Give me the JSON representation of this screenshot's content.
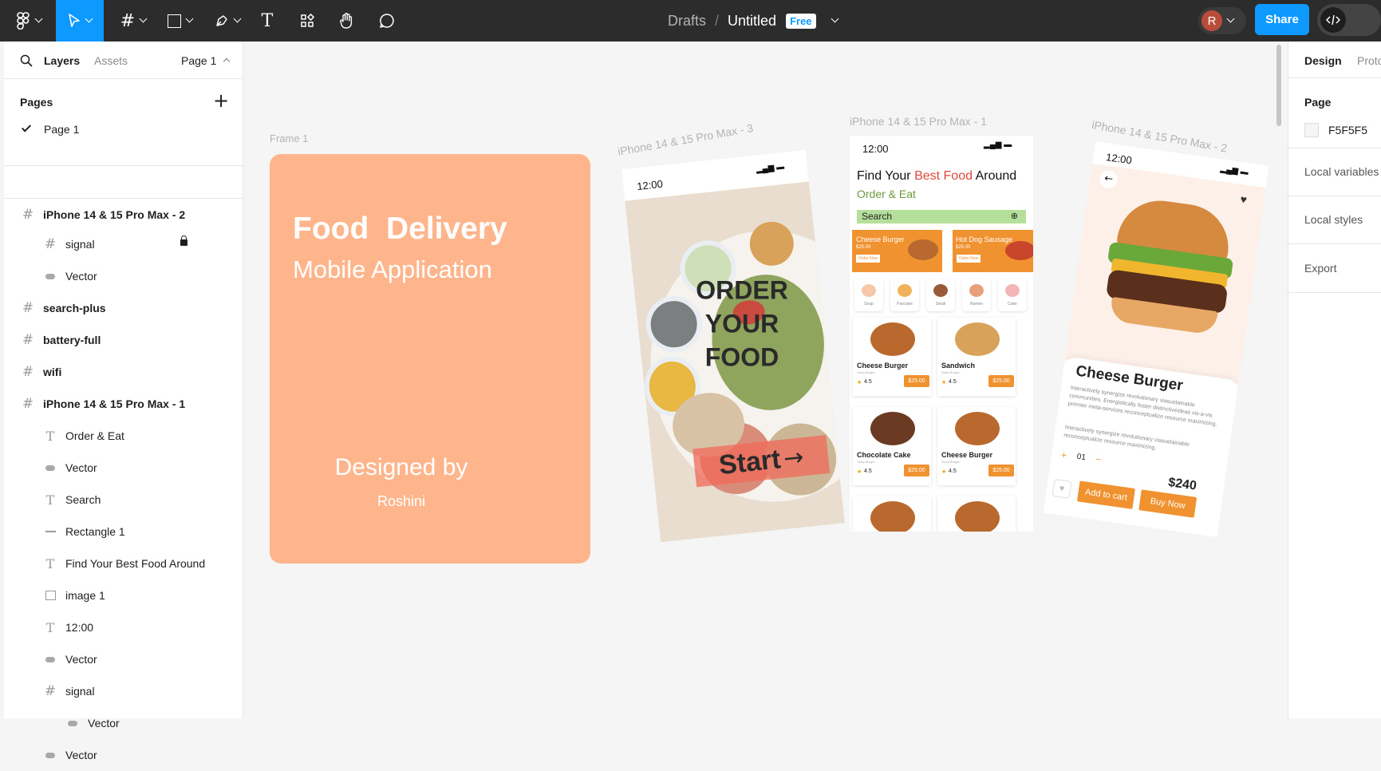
{
  "topbar": {
    "breadcrumb_drafts": "Drafts",
    "breadcrumb_sep": "/",
    "file_name": "Untitled",
    "plan_badge": "Free",
    "avatar_initial": "R",
    "share_label": "Share",
    "tools": [
      "main-menu-icon",
      "move-tool-icon",
      "frame-tool-icon",
      "shape-tool-icon",
      "pen-tool-icon",
      "text-tool-icon",
      "resources-icon",
      "hand-tool-icon",
      "comment-tool-icon"
    ]
  },
  "leftpanel": {
    "tab_layers": "Layers",
    "tab_assets": "Assets",
    "page_selector": "Page 1",
    "pages_heading": "Pages",
    "pages": [
      "Page 1"
    ],
    "layers": [
      {
        "label": "iPhone 14 & 15 Pro Max - 2",
        "icon": "frame-icon",
        "level": 0
      },
      {
        "label": "signal",
        "icon": "frame-icon",
        "level": 1,
        "locked": true
      },
      {
        "label": "Vector",
        "icon": "vector-icon",
        "level": 1
      },
      {
        "label": "search-plus",
        "icon": "frame-icon",
        "level": 0
      },
      {
        "label": "battery-full",
        "icon": "frame-icon",
        "level": 0
      },
      {
        "label": "wifi",
        "icon": "frame-icon",
        "level": 0
      },
      {
        "label": "iPhone 14 & 15 Pro Max - 1",
        "icon": "frame-icon",
        "level": 0
      },
      {
        "label": "Order & Eat",
        "icon": "text-icon",
        "level": 1
      },
      {
        "label": "Vector",
        "icon": "vector-icon",
        "level": 1
      },
      {
        "label": "Search",
        "icon": "text-icon",
        "level": 1
      },
      {
        "label": "Rectangle 1",
        "icon": "line-icon",
        "level": 1
      },
      {
        "label": "Find Your Best Food Around",
        "icon": "text-icon",
        "level": 1
      },
      {
        "label": "image 1",
        "icon": "image-icon",
        "level": 1
      },
      {
        "label": "12:00",
        "icon": "text-icon",
        "level": 1
      },
      {
        "label": "Vector",
        "icon": "vector-icon",
        "level": 1
      },
      {
        "label": "signal",
        "icon": "frame-icon",
        "level": 1
      },
      {
        "label": "Vector",
        "icon": "vector-icon",
        "level": 2
      },
      {
        "label": "Vector",
        "icon": "vector-icon",
        "level": 1
      }
    ]
  },
  "rightpanel": {
    "tab_design": "Design",
    "tab_prototype": "Proto",
    "page_heading": "Page",
    "page_color": "F5F5F5",
    "local_variables": "Local variables",
    "local_styles": "Local styles",
    "export": "Export"
  },
  "canvas": {
    "frame1_label": "Frame 1",
    "frame1_title": "Food  Delivery",
    "frame1_subtitle": "Mobile Application",
    "frame1_designed": "Designed by",
    "frame1_author": "Roshini",
    "phone3_label": "iPhone 14 & 15 Pro Max - 3",
    "phone3_time": "12:00",
    "phone3_heading_1": "ORDER",
    "phone3_heading_2": "YOUR",
    "phone3_heading_3": "FOOD",
    "phone3_button": "Start",
    "phone1_label": "iPhone 14 & 15 Pro Max - 1",
    "phone1_time": "12:00",
    "phone1_title_a": "Find Your ",
    "phone1_title_b": "Best Food",
    "phone1_title_c": " Around",
    "phone1_subtitle": "Order & Eat",
    "phone1_search": "Search",
    "promo1_title": "Cheese Burger",
    "promo1_price": "$25.00",
    "promo2_title": "Hot Dog Sausage",
    "promo2_price": "$25.00",
    "promo_btn": "Order Now",
    "categories": [
      "Soup",
      "Pancake",
      "Steak",
      "Ramen",
      "Cake"
    ],
    "items": [
      {
        "name": "Cheese Burger",
        "sub": "Spicy Burger",
        "rating": "4.5",
        "price": "$25.00"
      },
      {
        "name": "Sandwich",
        "sub": "Spicy Burger",
        "rating": "4.5",
        "price": "$25.00"
      },
      {
        "name": "Chocolate Cake",
        "sub": "Spicy Burger",
        "rating": "4.5",
        "price": "$25.00"
      },
      {
        "name": "Cheese Burger",
        "sub": "Spicy Burger",
        "rating": "4.5",
        "price": "$25.00"
      }
    ],
    "phone2_label": "iPhone 14 & 15 Pro Max - 2",
    "phone2_time": "12:00",
    "phone2_title": "Cheese Burger",
    "phone2_desc1": "Interactively synergize revolutionary viasustainable communities. Energistically foster distinctiveideas vis-a-vis premier meta-services reconceptualize resource maximizing.",
    "phone2_desc2": "Interactively synergize revolutionary viasustainable reconceptualize resource maximizing.",
    "phone2_qty": "01",
    "phone2_plus": "+",
    "phone2_minus": "–",
    "phone2_price": "$240",
    "phone2_add": "Add to cart",
    "phone2_buy": "Buy Now"
  },
  "colors": {
    "accent": "#0d99ff",
    "toolbar": "#2c2c2c",
    "frame1_bg": "#ffb58c",
    "orange": "#f0922f",
    "search_green": "#b5e09b",
    "subtitle_green": "#6f9a3a",
    "best_food_red": "#e0483b"
  }
}
